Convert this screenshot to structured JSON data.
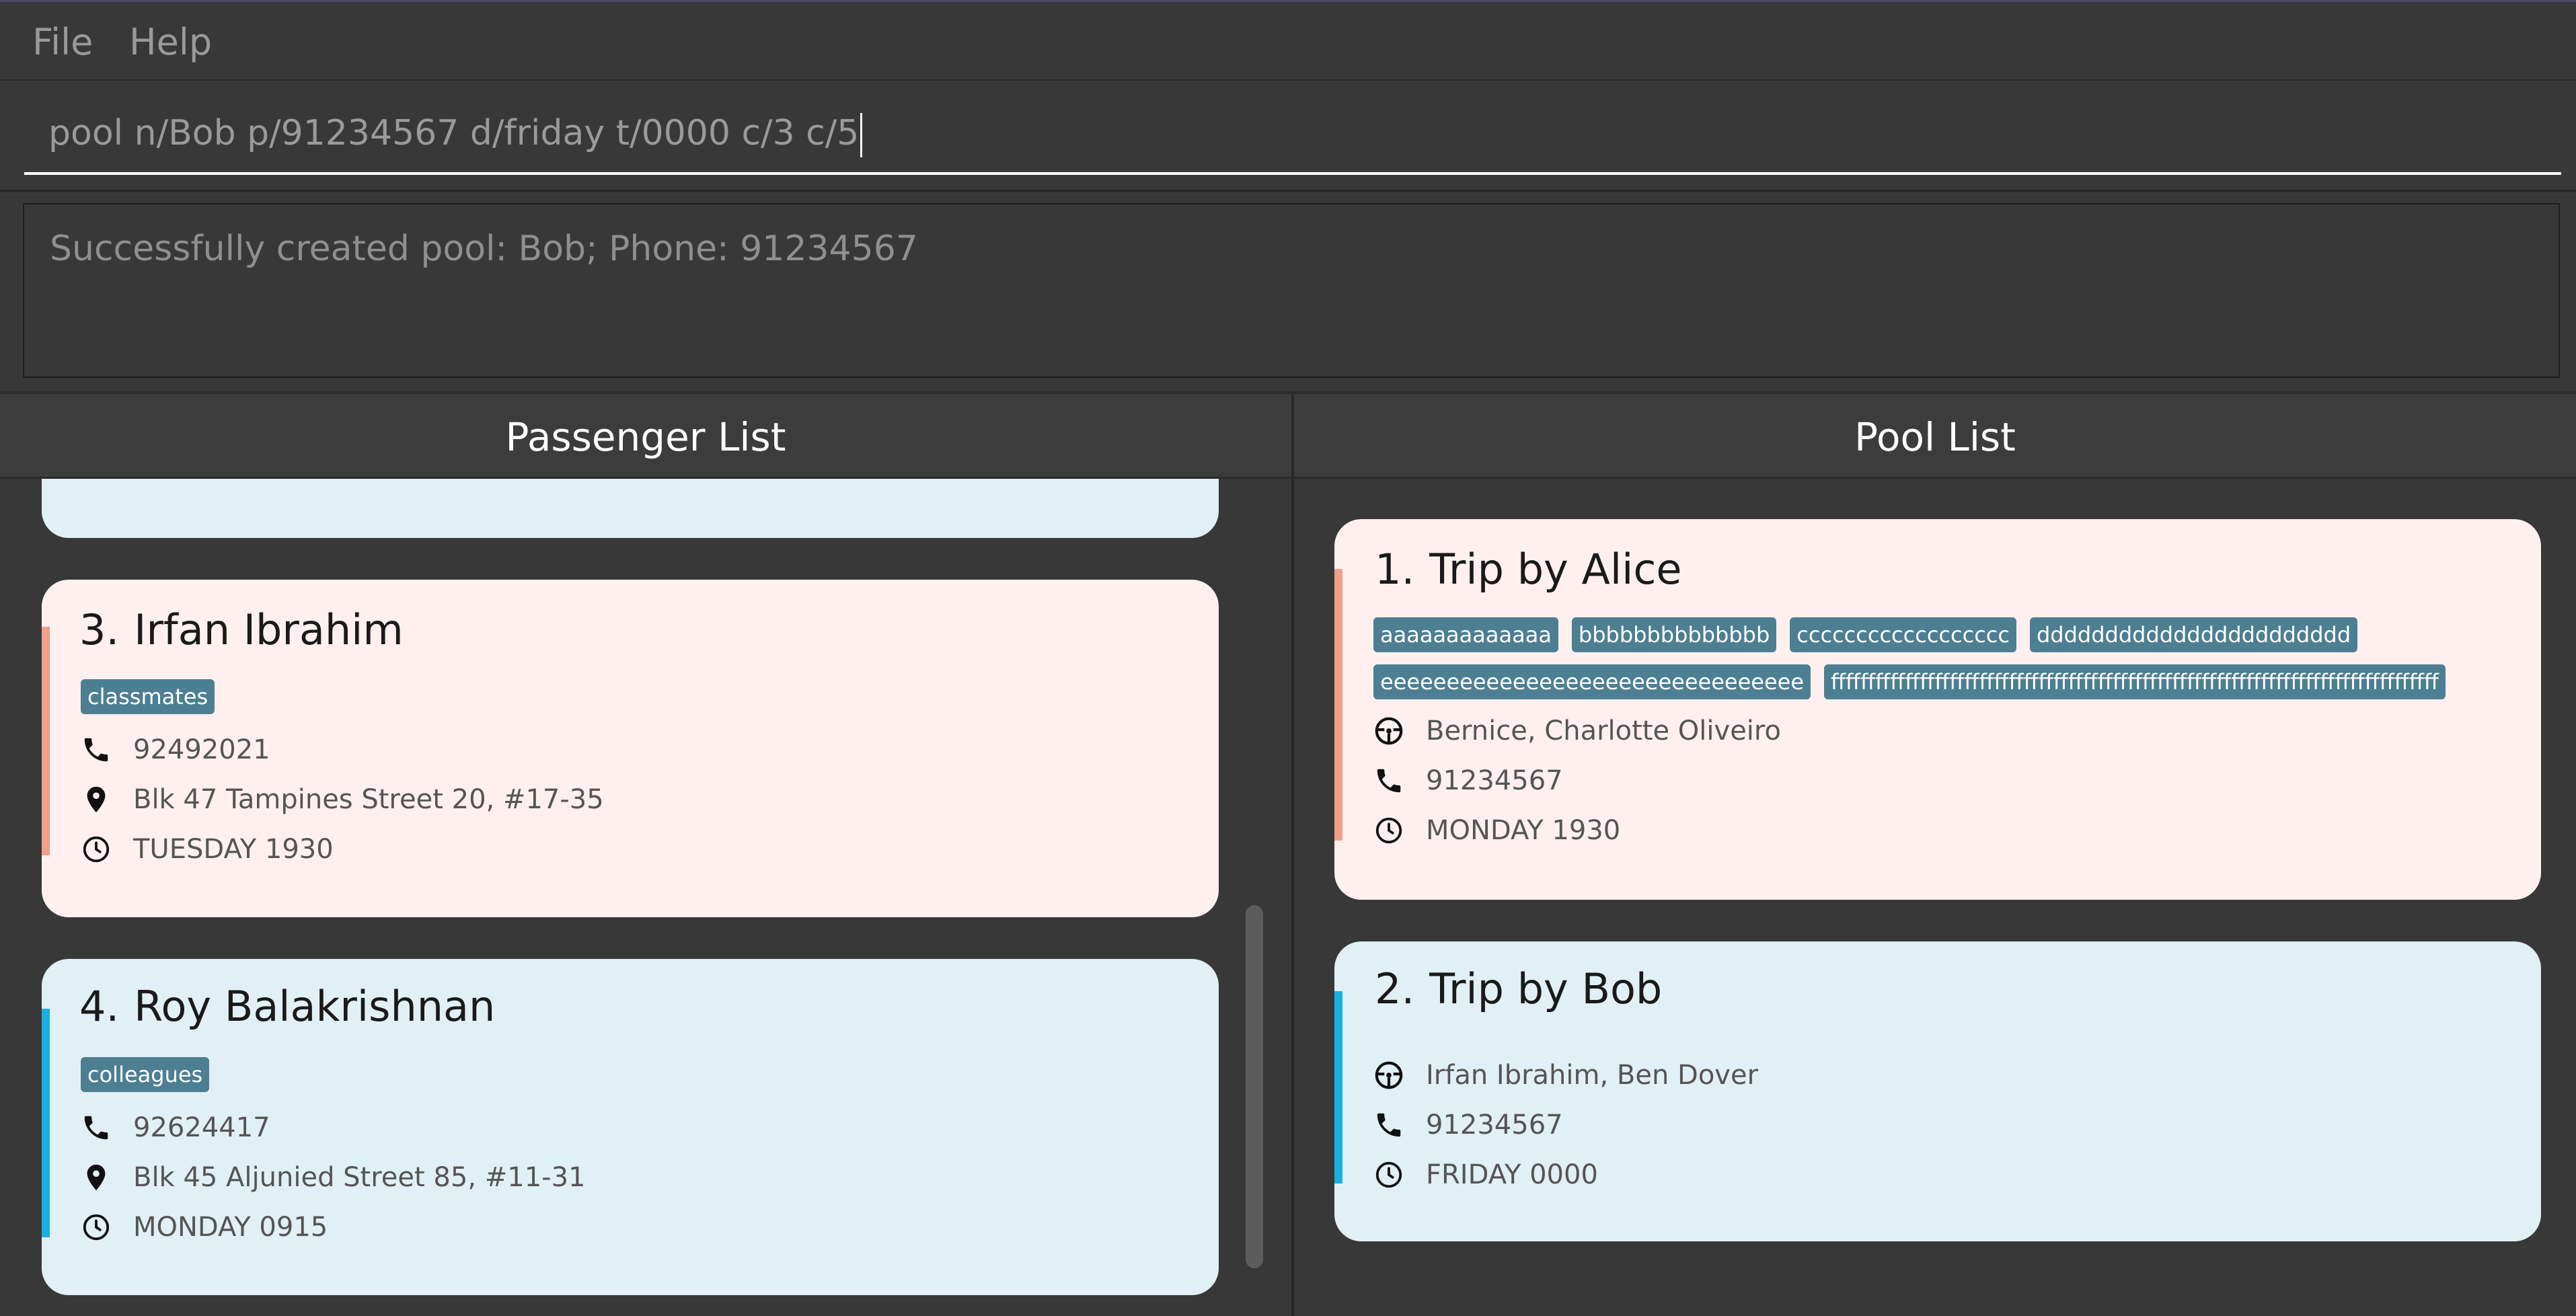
{
  "menu": {
    "file": "File",
    "help": "Help"
  },
  "command": {
    "value": "pool n/Bob p/91234567 d/friday t/0000 c/3 c/5"
  },
  "result": {
    "text": "Successfully created pool: Bob; Phone: 91234567"
  },
  "panels": {
    "passenger_header": "Passenger List",
    "pool_header": "Pool List"
  },
  "passengers": [
    {
      "index": "3.",
      "name": "Irfan Ibrahim",
      "tag": "classmates",
      "phone": "92492021",
      "address": "Blk 47 Tampines Street 20, #17-35",
      "time": "TUESDAY 1930"
    },
    {
      "index": "4.",
      "name": "Roy Balakrishnan",
      "tag": "colleagues",
      "phone": "92624417",
      "address": "Blk 45 Aljunied Street 85, #11-31",
      "time": "MONDAY 0915"
    }
  ],
  "pools": [
    {
      "index": "1.",
      "title": "Trip by Alice",
      "tags": [
        "aaaaaaaaaaaaa",
        "bbbbbbbbbbbbbb",
        "cccccccccccccccccc",
        "ddddddddddddddddddddddd",
        "eeeeeeeeeeeeeeeeeeeeeeeeeeeeeeee",
        "ffffffffffffffffffffffffffffffffffffffffffffffffffffffffffffffffffffffffffffffffff"
      ],
      "passengers": "Bernice, Charlotte Oliveiro",
      "phone": "91234567",
      "time": "MONDAY 1930"
    },
    {
      "index": "2.",
      "title": "Trip by Bob",
      "passengers": "Irfan Ibrahim, Ben Dover",
      "phone": "91234567",
      "time": "FRIDAY 0000"
    }
  ],
  "colors": {
    "card_pink": "#fff0ef",
    "card_blue": "#e1f0f5",
    "accent_pink": "#f0a08a",
    "accent_blue": "#1ab0e0",
    "tag_bg": "#4d7f92"
  },
  "icons": {
    "phone": "phone-icon",
    "address": "map-pin-icon",
    "time": "clock-icon",
    "driver": "steering-wheel-icon"
  }
}
